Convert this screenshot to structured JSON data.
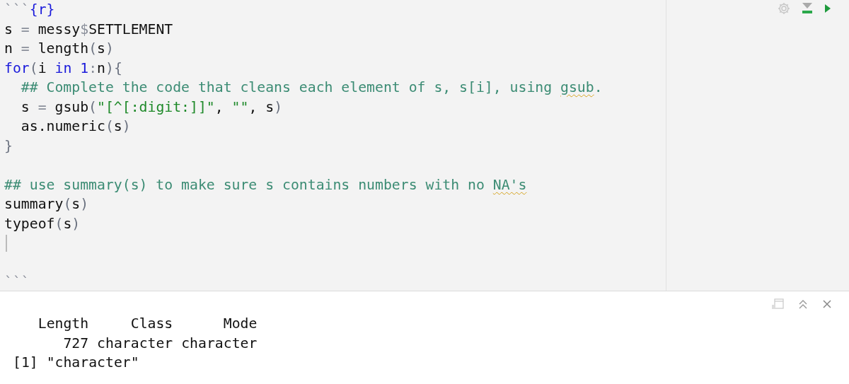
{
  "editor": {
    "lines": [
      {
        "kind": "code",
        "tokens": [
          {
            "text": "```",
            "kind": "op"
          },
          {
            "text": "{r}",
            "kind": "keyword"
          }
        ]
      },
      {
        "kind": "code",
        "tokens": [
          {
            "text": "s ",
            "kind": "plain"
          },
          {
            "text": "=",
            "kind": "op"
          },
          {
            "text": " messy",
            "kind": "plain"
          },
          {
            "text": "$",
            "kind": "op"
          },
          {
            "text": "SETTLEMENT",
            "kind": "plain"
          }
        ]
      },
      {
        "kind": "code",
        "tokens": [
          {
            "text": "n ",
            "kind": "plain"
          },
          {
            "text": "=",
            "kind": "op"
          },
          {
            "text": " length",
            "kind": "plain"
          },
          {
            "text": "(",
            "kind": "paren"
          },
          {
            "text": "s",
            "kind": "plain"
          },
          {
            "text": ")",
            "kind": "paren"
          }
        ]
      },
      {
        "kind": "code",
        "tokens": [
          {
            "text": "for",
            "kind": "keyword"
          },
          {
            "text": "(",
            "kind": "paren"
          },
          {
            "text": "i ",
            "kind": "plain"
          },
          {
            "text": "in",
            "kind": "keyword"
          },
          {
            "text": " 1",
            "kind": "keyword"
          },
          {
            "text": ":",
            "kind": "op"
          },
          {
            "text": "n",
            "kind": "plain"
          },
          {
            "text": "){",
            "kind": "paren"
          }
        ]
      },
      {
        "kind": "code",
        "tokens": [
          {
            "text": "  ## Complete the code that cleans each element of s, s[i], using ",
            "kind": "comment"
          },
          {
            "text": "gsub",
            "kind": "comment_flagged"
          },
          {
            "text": ".",
            "kind": "comment"
          }
        ]
      },
      {
        "kind": "code",
        "tokens": [
          {
            "text": "  s ",
            "kind": "plain"
          },
          {
            "text": "=",
            "kind": "op"
          },
          {
            "text": " gsub",
            "kind": "plain"
          },
          {
            "text": "(",
            "kind": "paren"
          },
          {
            "text": "\"[^[:digit:]]\"",
            "kind": "string"
          },
          {
            "text": ", ",
            "kind": "plain"
          },
          {
            "text": "\"\"",
            "kind": "string"
          },
          {
            "text": ", s",
            "kind": "plain"
          },
          {
            "text": ")",
            "kind": "paren"
          }
        ]
      },
      {
        "kind": "code",
        "tokens": [
          {
            "text": "  as.numeric",
            "kind": "plain"
          },
          {
            "text": "(",
            "kind": "paren"
          },
          {
            "text": "s",
            "kind": "plain"
          },
          {
            "text": ")",
            "kind": "paren"
          }
        ]
      },
      {
        "kind": "code",
        "tokens": [
          {
            "text": "}",
            "kind": "paren"
          }
        ]
      },
      {
        "kind": "blank"
      },
      {
        "kind": "code",
        "tokens": [
          {
            "text": "## use summary(s) to make sure s contains numbers with no ",
            "kind": "comment"
          },
          {
            "text": "NA's",
            "kind": "comment_flagged"
          }
        ]
      },
      {
        "kind": "code",
        "tokens": [
          {
            "text": "summary",
            "kind": "plain"
          },
          {
            "text": "(",
            "kind": "paren"
          },
          {
            "text": "s",
            "kind": "plain"
          },
          {
            "text": ")",
            "kind": "paren"
          }
        ]
      },
      {
        "kind": "code",
        "tokens": [
          {
            "text": "typeof",
            "kind": "plain"
          },
          {
            "text": "(",
            "kind": "paren"
          },
          {
            "text": "s",
            "kind": "plain"
          },
          {
            "text": ")",
            "kind": "paren"
          }
        ]
      },
      {
        "kind": "cursor"
      },
      {
        "kind": "blank"
      },
      {
        "kind": "code",
        "tokens": [
          {
            "text": "```",
            "kind": "op"
          }
        ]
      }
    ]
  },
  "output": {
    "lines": [
      "   Length     Class      Mode",
      "      727 character character",
      "[1] \"character\""
    ]
  }
}
